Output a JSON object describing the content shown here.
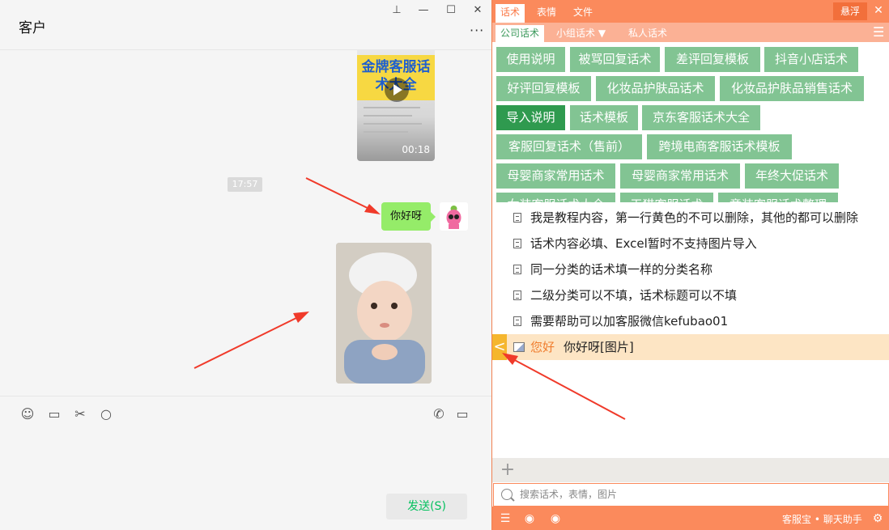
{
  "chat": {
    "title": "客户",
    "window_buttons": [
      "⊥",
      "—",
      "☐",
      "✕"
    ],
    "more_label": "···",
    "video": {
      "banner_text": "金牌客服话术大全",
      "duration": "00:18"
    },
    "time_divider": "17:57",
    "message_text": "你好呀",
    "send_label": "发送(S)"
  },
  "panel": {
    "top_tabs": [
      {
        "label": "话术",
        "active": true
      },
      {
        "label": "表情",
        "active": false
      },
      {
        "label": "文件",
        "active": false
      }
    ],
    "float_label": "悬浮",
    "close_label": "✕",
    "sub_tabs": [
      {
        "label": "公司话术",
        "active": true
      },
      {
        "label": "小组话术 ▼",
        "active": false
      },
      {
        "label": "私人话术",
        "active": false
      }
    ],
    "categories": [
      {
        "label": "使用说明",
        "selected": false
      },
      {
        "label": "被骂回复话术",
        "selected": false
      },
      {
        "label": "差评回复模板",
        "selected": false
      },
      {
        "label": "抖音小店话术",
        "selected": false
      },
      {
        "label": "好评回复模板",
        "selected": false
      },
      {
        "label": "化妆品护肤品话术",
        "selected": false
      },
      {
        "label": "化妆品护肤品销售话术",
        "selected": false
      },
      {
        "label": "导入说明",
        "selected": true
      },
      {
        "label": "话术模板",
        "selected": false
      },
      {
        "label": "京东客服话术大全",
        "selected": false
      },
      {
        "label": "客服回复话术（售前）",
        "selected": false
      },
      {
        "label": "跨境电商客服话术模板",
        "selected": false
      },
      {
        "label": "母婴商家常用话术",
        "selected": false
      },
      {
        "label": "母婴商家常用话术",
        "selected": false
      },
      {
        "label": "年终大促话术",
        "selected": false
      },
      {
        "label": "女装客服话术大全",
        "selected": false
      },
      {
        "label": "天猫客服话术",
        "selected": false
      },
      {
        "label": "童装客服话术整理",
        "selected": false
      }
    ],
    "scripts": [
      "我是教程内容，第一行黄色的不可以删除，其他的都可以删除",
      "话术内容必填、Excel暂时不支持图片导入",
      "同一分类的话术填一样的分类名称",
      "二级分类可以不填，话术标题可以不填",
      "需要帮助可以加客服微信kefubao01"
    ],
    "highlight_script": {
      "keyword": "您好",
      "text": "你好呀[图片]"
    },
    "search_placeholder": "搜索话术，表情，图片",
    "brand_label": "客服宝 • 聊天助手"
  },
  "colors": {
    "accent": "#fb8a5c",
    "category_green": "#82c493",
    "category_selected": "#2f9a4f",
    "chat_bubble": "#95ec69"
  }
}
